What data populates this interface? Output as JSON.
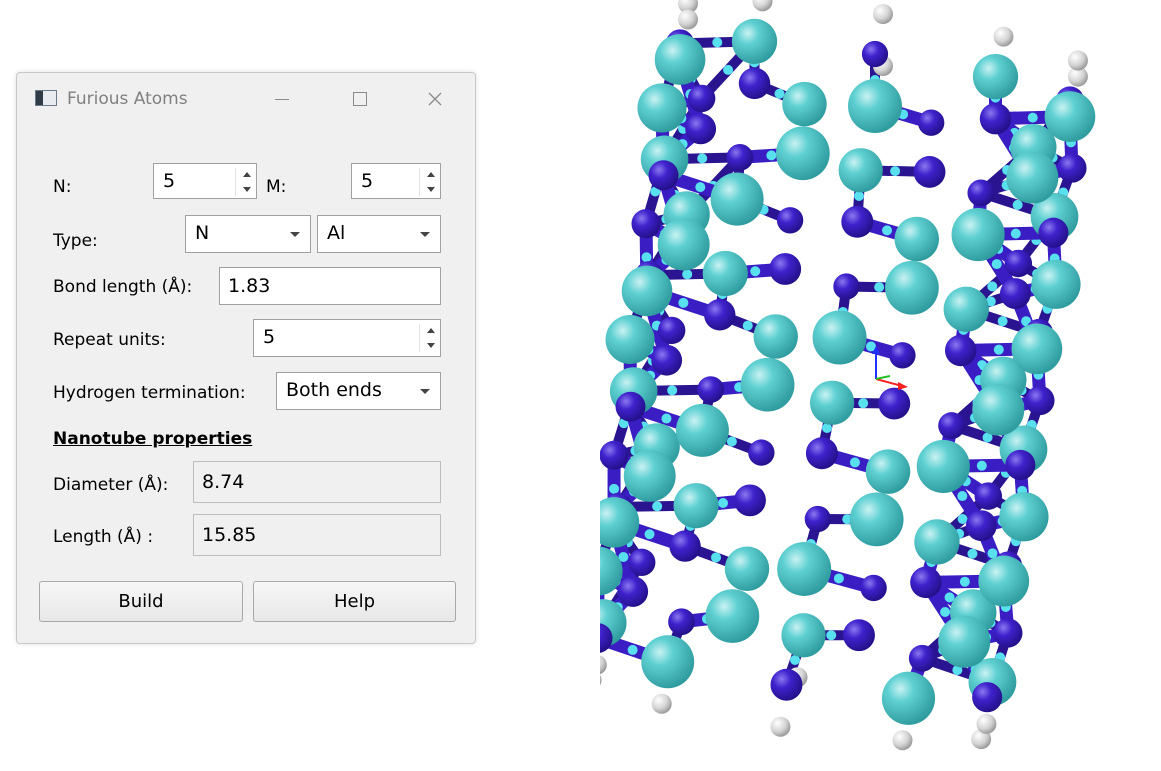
{
  "window": {
    "title": "Furious Atoms"
  },
  "form": {
    "n_label": "N:",
    "n_value": "5",
    "m_label": "M:",
    "m_value": "5",
    "type_label": "Type:",
    "type_a": "N",
    "type_b": "Al",
    "bond_label": "Bond length (Å):",
    "bond_value": "1.83",
    "repeat_label": "Repeat units:",
    "repeat_value": "5",
    "hydrogen_label": "Hydrogen termination:",
    "hydrogen_value": "Both ends"
  },
  "properties": {
    "heading": "Nanotube properties",
    "diameter_label": "Diameter (Å):",
    "diameter_value": "8.74",
    "length_label": "Length (Å)  :",
    "length_value": "15.85"
  },
  "buttons": {
    "build": "Build",
    "help": "Help"
  },
  "colors": {
    "aluminum": "#49c3c6",
    "nitrogen": "#3a1ec4",
    "hydrogen": "#d9d9d9",
    "bond": "#3a1ec4"
  },
  "icons": [
    "app-icon",
    "minimize-icon",
    "maximize-icon",
    "close-icon",
    "axes-icon"
  ]
}
